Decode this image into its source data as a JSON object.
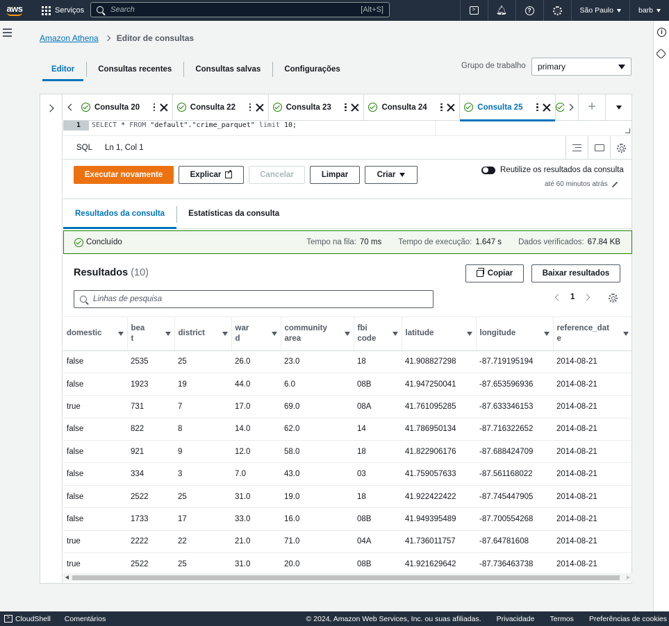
{
  "topnav": {
    "logo": "aws",
    "services_label": "Serviços",
    "search_placeholder": "Search",
    "search_shortcut": "[Alt+S]",
    "icons": [
      "cloudshell-icon",
      "bell-icon",
      "help-icon",
      "gear-icon"
    ],
    "region": "São Paulo",
    "user": "barb"
  },
  "breadcrumb": {
    "root": "Amazon Athena",
    "current": "Editor de consultas"
  },
  "main_tabs": [
    {
      "label": "Editor",
      "active": true
    },
    {
      "label": "Consultas recentes",
      "active": false
    },
    {
      "label": "Consultas salvas",
      "active": false
    },
    {
      "label": "Configurações",
      "active": false
    }
  ],
  "workgroup": {
    "label": "Grupo de trabalho",
    "value": "primary"
  },
  "query_tabs": [
    {
      "label": "Consulta 20",
      "active": false
    },
    {
      "label": "Consulta 22",
      "active": false
    },
    {
      "label": "Consulta 23",
      "active": false
    },
    {
      "label": "Consulta 24",
      "active": false
    },
    {
      "label": "Consulta 25",
      "active": true
    }
  ],
  "editor": {
    "line_number": "1",
    "sql_parts": [
      "SELECT",
      " * ",
      "FROM",
      " \"default\".\"crime_parquet\" ",
      "limit",
      " 10;"
    ],
    "language": "SQL",
    "cursor": "Ln 1, Col 1"
  },
  "actions": {
    "run_again": "Executar novamente",
    "explain": "Explicar",
    "cancel": "Cancelar",
    "clear": "Limpar",
    "create": "Criar",
    "reuse_label": "Reutilize os resultados da consulta",
    "reuse_sub": "até 60 minutos atrás",
    "reuse_enabled": false
  },
  "result_tabs": [
    {
      "label": "Resultados da consulta",
      "active": true
    },
    {
      "label": "Estatísticas da consulta",
      "active": false
    }
  ],
  "status": {
    "state": "Concluído",
    "queue_label": "Tempo na fila:",
    "queue_value": "70 ms",
    "exec_label": "Tempo de execução:",
    "exec_value": "1.647 s",
    "scanned_label": "Dados verificados:",
    "scanned_value": "67.84 KB"
  },
  "results": {
    "title": "Resultados",
    "count": "(10)",
    "copy_label": "Copiar",
    "download_label": "Baixar resultados",
    "filter_placeholder": "Linhas de pesquisa",
    "page": "1",
    "columns": [
      {
        "label": "domestic",
        "lines": [
          "domestic"
        ],
        "width": 92
      },
      {
        "label": "beat",
        "lines": [
          "bea",
          "t"
        ],
        "width": 68
      },
      {
        "label": "district",
        "lines": [
          "district"
        ],
        "width": 82
      },
      {
        "label": "ward",
        "lines": [
          "war",
          "d"
        ],
        "width": 71
      },
      {
        "label": "community area",
        "lines": [
          "community",
          "area"
        ],
        "width": 105
      },
      {
        "label": "fbi code",
        "lines": [
          "fbi",
          "code"
        ],
        "width": 69
      },
      {
        "label": "latitude",
        "lines": [
          "latitude"
        ],
        "width": 107
      },
      {
        "label": "longitude",
        "lines": [
          "longitude"
        ],
        "width": 111
      },
      {
        "label": "reference_date",
        "lines": [
          "reference_dat",
          "e"
        ],
        "width": 114
      }
    ],
    "rows": [
      [
        "false",
        "2535",
        "25",
        "26.0",
        "23.0",
        "18",
        "41.908827298",
        "-87.719195194",
        "2014-08-21"
      ],
      [
        "false",
        "1923",
        "19",
        "44.0",
        "6.0",
        "08B",
        "41.947250041",
        "-87.653596936",
        "2014-08-21"
      ],
      [
        "true",
        "731",
        "7",
        "17.0",
        "69.0",
        "08A",
        "41.761095285",
        "-87.633346153",
        "2014-08-21"
      ],
      [
        "false",
        "822",
        "8",
        "14.0",
        "62.0",
        "14",
        "41.786950134",
        "-87.716322652",
        "2014-08-21"
      ],
      [
        "false",
        "921",
        "9",
        "12.0",
        "58.0",
        "18",
        "41.822906176",
        "-87.688424709",
        "2014-08-21"
      ],
      [
        "false",
        "334",
        "3",
        "7.0",
        "43.0",
        "03",
        "41.759057633",
        "-87.561168022",
        "2014-08-21"
      ],
      [
        "false",
        "2522",
        "25",
        "31.0",
        "19.0",
        "18",
        "41.922422422",
        "-87.745447905",
        "2014-08-21"
      ],
      [
        "false",
        "1733",
        "17",
        "33.0",
        "16.0",
        "08B",
        "41.949395489",
        "-87.700554268",
        "2014-08-21"
      ],
      [
        "true",
        "2222",
        "22",
        "21.0",
        "71.0",
        "04A",
        "41.736011757",
        "-87.64781608",
        "2014-08-21"
      ],
      [
        "true",
        "2522",
        "25",
        "31.0",
        "20.0",
        "08B",
        "41.921629642",
        "-87.736463738",
        "2014-08-21"
      ]
    ]
  },
  "footer": {
    "cloudshell": "CloudShell",
    "feedback": "Comentários",
    "copyright": "© 2024, Amazon Web Services, Inc. ou suas afiliadas.",
    "privacy": "Privacidade",
    "terms": "Termos",
    "cookies": "Preferências de cookies"
  }
}
